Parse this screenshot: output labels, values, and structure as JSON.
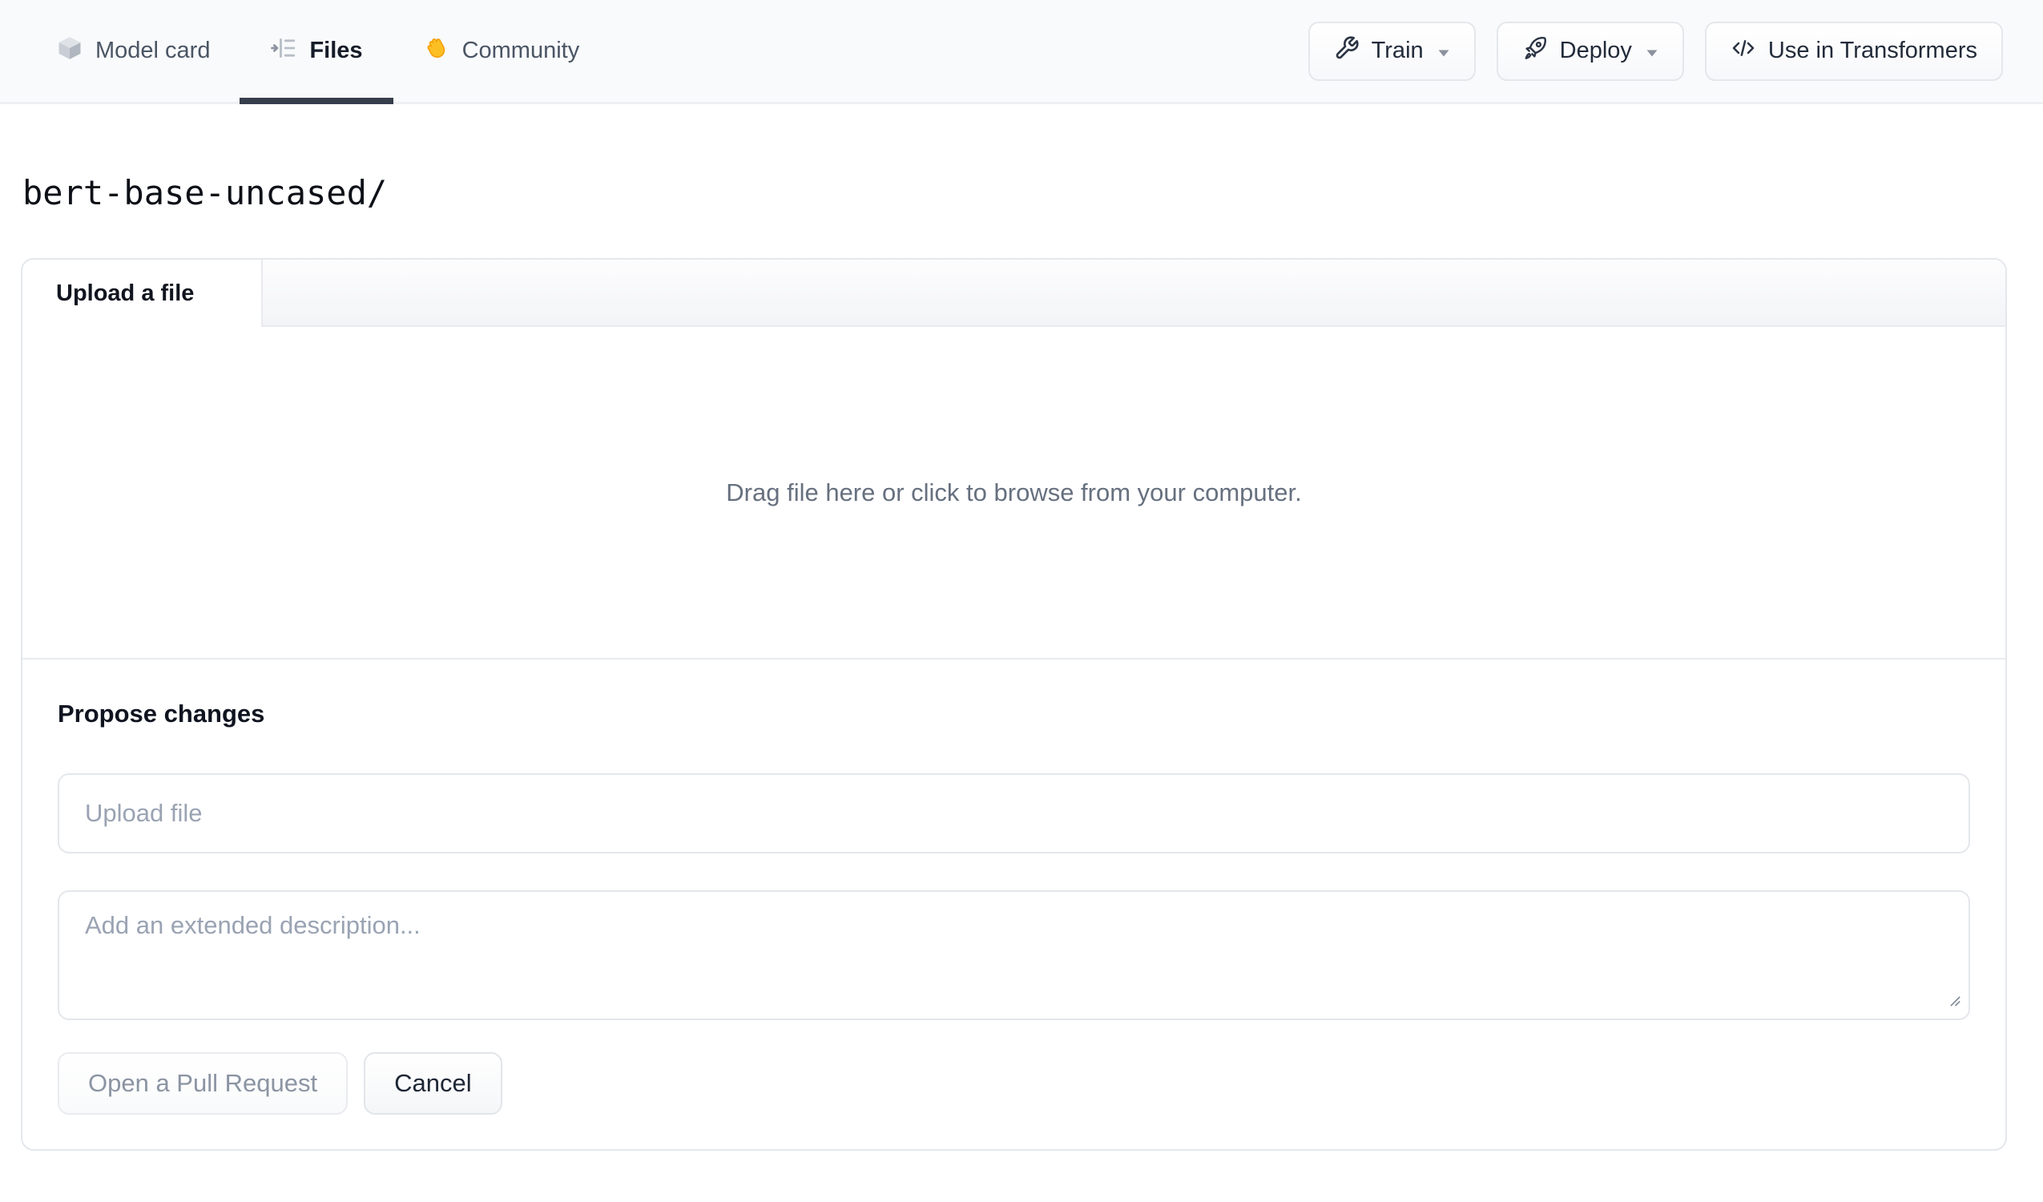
{
  "header": {
    "tabs": [
      {
        "label": "Model card",
        "icon": "cube-icon",
        "active": false
      },
      {
        "label": "Files",
        "icon": "files-icon",
        "active": true
      },
      {
        "label": "Community",
        "icon": "waving-hand-icon",
        "active": false
      }
    ],
    "actions": [
      {
        "label": "Train",
        "icon": "wrench-icon",
        "has_dropdown": true
      },
      {
        "label": "Deploy",
        "icon": "rocket-icon",
        "has_dropdown": true
      },
      {
        "label": "Use in Transformers",
        "icon": "code-icon",
        "has_dropdown": false
      }
    ]
  },
  "breadcrumb": {
    "path": "bert-base-uncased/"
  },
  "upload_card": {
    "tab_label": "Upload a file",
    "dropzone_text": "Drag file here or click to browse from your computer.",
    "propose": {
      "heading": "Propose changes",
      "filename_placeholder": "Upload file",
      "description_placeholder": "Add an extended description...",
      "buttons": {
        "submit": "Open a Pull Request",
        "cancel": "Cancel"
      }
    }
  },
  "colors": {
    "header_bg": "#f9fafb",
    "active_tab_underline": "#363e4c",
    "active_tab_text": "#151c28",
    "inactive_tab_text": "#4a5565",
    "border": "#e4e7eb",
    "placeholder_text": "#9aa3b3",
    "dropzone_text": "#66707f",
    "disabled_button_text": "#8b94a3",
    "hand_emoji_yellow": "#fbbf24"
  }
}
